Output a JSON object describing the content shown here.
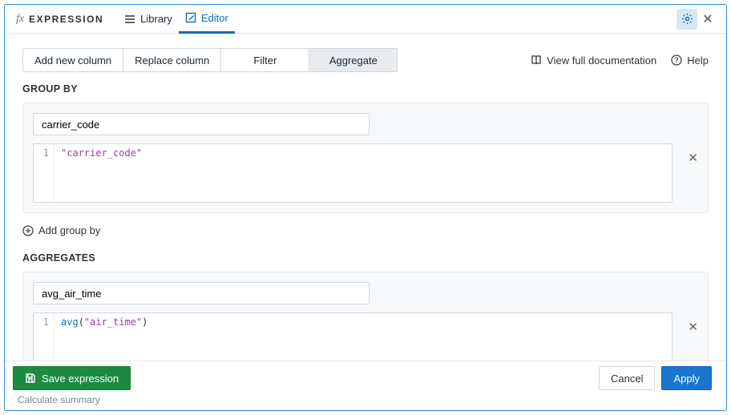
{
  "header": {
    "title": "EXPRESSION",
    "fx": "fx",
    "tabs": {
      "library": "Library",
      "editor": "Editor"
    }
  },
  "toolbar": {
    "add_new_column": "Add new column",
    "replace_column": "Replace column",
    "filter": "Filter",
    "aggregate": "Aggregate",
    "view_docs": "View full documentation",
    "help": "Help"
  },
  "sections": {
    "group_by_label": "GROUP BY",
    "aggregates_label": "AGGREGATES",
    "add_group_by": "Add group by"
  },
  "groupby": {
    "name": "carrier_code",
    "code_line_no": "1",
    "code_tokens": {
      "str": "\"carrier_code\""
    }
  },
  "aggregate": {
    "name": "avg_air_time",
    "code_line_no": "1",
    "code_tokens": {
      "fn": "avg",
      "open": "(",
      "str": "\"air_time\"",
      "close": ")"
    }
  },
  "footer": {
    "save": "Save expression",
    "cancel": "Cancel",
    "apply": "Apply",
    "hint": "Calculate summary"
  }
}
